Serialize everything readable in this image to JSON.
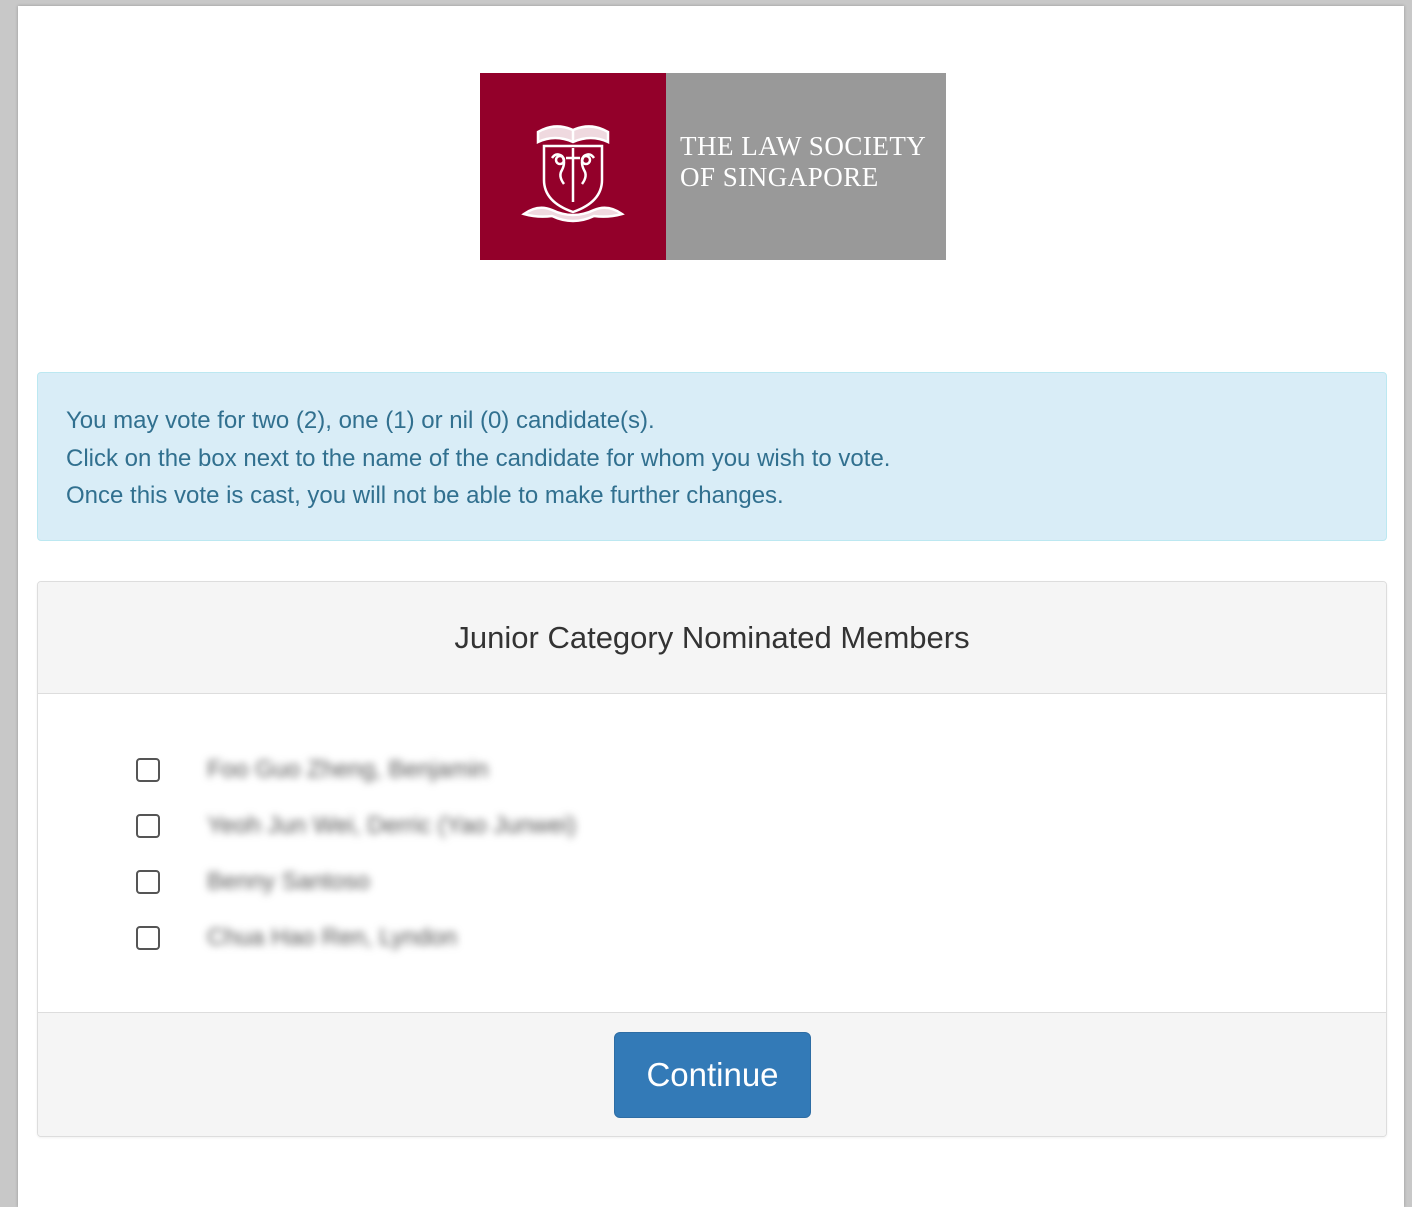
{
  "logo": {
    "line1": "THE LAW SOCIETY",
    "line2": "OF SINGAPORE",
    "crest_icon": "law-society-crest-icon",
    "crest_color": "#93002a",
    "text_bg_color": "#999999"
  },
  "instructions": {
    "line1": "You may vote for two (2), one (1) or nil (0) candidate(s).",
    "line2": "Click on the box next to the name of the candidate for whom you wish to vote.",
    "line3": "Once this vote is cast, you will not be able to make further changes."
  },
  "panel": {
    "title": "Junior Category Nominated Members",
    "candidates": [
      {
        "name": "Foo Guo Zheng, Benjamin",
        "checked": false
      },
      {
        "name": "Yeoh Jun Wei, Derric (Yao Junwei)",
        "checked": false
      },
      {
        "name": "Benny Santoso",
        "checked": false
      },
      {
        "name": "Chua Hao Ren, Lyndon",
        "checked": false
      }
    ],
    "continue_label": "Continue",
    "button_color": "#337ab7"
  }
}
